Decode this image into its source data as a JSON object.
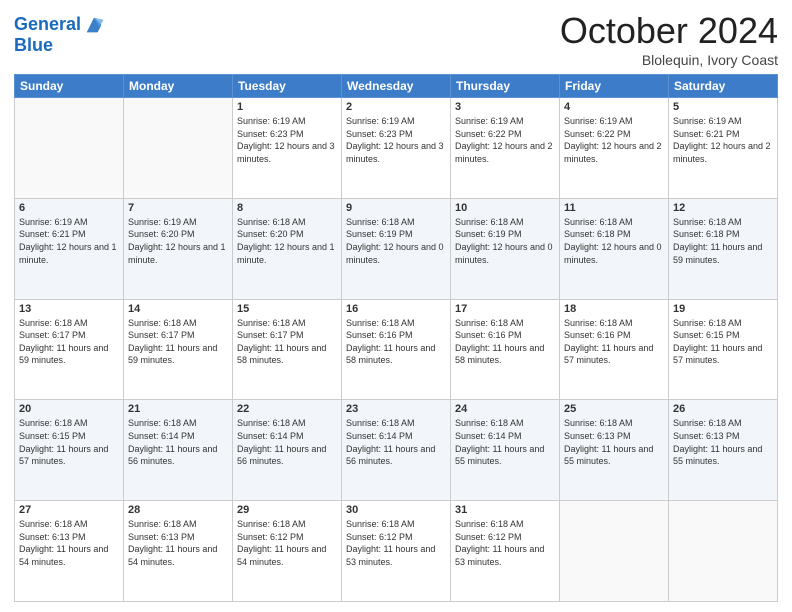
{
  "header": {
    "logo_line1": "General",
    "logo_line2": "Blue",
    "month": "October 2024",
    "location": "Blolequin, Ivory Coast"
  },
  "weekdays": [
    "Sunday",
    "Monday",
    "Tuesday",
    "Wednesday",
    "Thursday",
    "Friday",
    "Saturday"
  ],
  "weeks": [
    [
      {
        "day": "",
        "info": ""
      },
      {
        "day": "",
        "info": ""
      },
      {
        "day": "1",
        "info": "Sunrise: 6:19 AM\nSunset: 6:23 PM\nDaylight: 12 hours and 3 minutes."
      },
      {
        "day": "2",
        "info": "Sunrise: 6:19 AM\nSunset: 6:23 PM\nDaylight: 12 hours and 3 minutes."
      },
      {
        "day": "3",
        "info": "Sunrise: 6:19 AM\nSunset: 6:22 PM\nDaylight: 12 hours and 2 minutes."
      },
      {
        "day": "4",
        "info": "Sunrise: 6:19 AM\nSunset: 6:22 PM\nDaylight: 12 hours and 2 minutes."
      },
      {
        "day": "5",
        "info": "Sunrise: 6:19 AM\nSunset: 6:21 PM\nDaylight: 12 hours and 2 minutes."
      }
    ],
    [
      {
        "day": "6",
        "info": "Sunrise: 6:19 AM\nSunset: 6:21 PM\nDaylight: 12 hours and 1 minute."
      },
      {
        "day": "7",
        "info": "Sunrise: 6:19 AM\nSunset: 6:20 PM\nDaylight: 12 hours and 1 minute."
      },
      {
        "day": "8",
        "info": "Sunrise: 6:18 AM\nSunset: 6:20 PM\nDaylight: 12 hours and 1 minute."
      },
      {
        "day": "9",
        "info": "Sunrise: 6:18 AM\nSunset: 6:19 PM\nDaylight: 12 hours and 0 minutes."
      },
      {
        "day": "10",
        "info": "Sunrise: 6:18 AM\nSunset: 6:19 PM\nDaylight: 12 hours and 0 minutes."
      },
      {
        "day": "11",
        "info": "Sunrise: 6:18 AM\nSunset: 6:18 PM\nDaylight: 12 hours and 0 minutes."
      },
      {
        "day": "12",
        "info": "Sunrise: 6:18 AM\nSunset: 6:18 PM\nDaylight: 11 hours and 59 minutes."
      }
    ],
    [
      {
        "day": "13",
        "info": "Sunrise: 6:18 AM\nSunset: 6:17 PM\nDaylight: 11 hours and 59 minutes."
      },
      {
        "day": "14",
        "info": "Sunrise: 6:18 AM\nSunset: 6:17 PM\nDaylight: 11 hours and 59 minutes."
      },
      {
        "day": "15",
        "info": "Sunrise: 6:18 AM\nSunset: 6:17 PM\nDaylight: 11 hours and 58 minutes."
      },
      {
        "day": "16",
        "info": "Sunrise: 6:18 AM\nSunset: 6:16 PM\nDaylight: 11 hours and 58 minutes."
      },
      {
        "day": "17",
        "info": "Sunrise: 6:18 AM\nSunset: 6:16 PM\nDaylight: 11 hours and 58 minutes."
      },
      {
        "day": "18",
        "info": "Sunrise: 6:18 AM\nSunset: 6:16 PM\nDaylight: 11 hours and 57 minutes."
      },
      {
        "day": "19",
        "info": "Sunrise: 6:18 AM\nSunset: 6:15 PM\nDaylight: 11 hours and 57 minutes."
      }
    ],
    [
      {
        "day": "20",
        "info": "Sunrise: 6:18 AM\nSunset: 6:15 PM\nDaylight: 11 hours and 57 minutes."
      },
      {
        "day": "21",
        "info": "Sunrise: 6:18 AM\nSunset: 6:14 PM\nDaylight: 11 hours and 56 minutes."
      },
      {
        "day": "22",
        "info": "Sunrise: 6:18 AM\nSunset: 6:14 PM\nDaylight: 11 hours and 56 minutes."
      },
      {
        "day": "23",
        "info": "Sunrise: 6:18 AM\nSunset: 6:14 PM\nDaylight: 11 hours and 56 minutes."
      },
      {
        "day": "24",
        "info": "Sunrise: 6:18 AM\nSunset: 6:14 PM\nDaylight: 11 hours and 55 minutes."
      },
      {
        "day": "25",
        "info": "Sunrise: 6:18 AM\nSunset: 6:13 PM\nDaylight: 11 hours and 55 minutes."
      },
      {
        "day": "26",
        "info": "Sunrise: 6:18 AM\nSunset: 6:13 PM\nDaylight: 11 hours and 55 minutes."
      }
    ],
    [
      {
        "day": "27",
        "info": "Sunrise: 6:18 AM\nSunset: 6:13 PM\nDaylight: 11 hours and 54 minutes."
      },
      {
        "day": "28",
        "info": "Sunrise: 6:18 AM\nSunset: 6:13 PM\nDaylight: 11 hours and 54 minutes."
      },
      {
        "day": "29",
        "info": "Sunrise: 6:18 AM\nSunset: 6:12 PM\nDaylight: 11 hours and 54 minutes."
      },
      {
        "day": "30",
        "info": "Sunrise: 6:18 AM\nSunset: 6:12 PM\nDaylight: 11 hours and 53 minutes."
      },
      {
        "day": "31",
        "info": "Sunrise: 6:18 AM\nSunset: 6:12 PM\nDaylight: 11 hours and 53 minutes."
      },
      {
        "day": "",
        "info": ""
      },
      {
        "day": "",
        "info": ""
      }
    ]
  ]
}
